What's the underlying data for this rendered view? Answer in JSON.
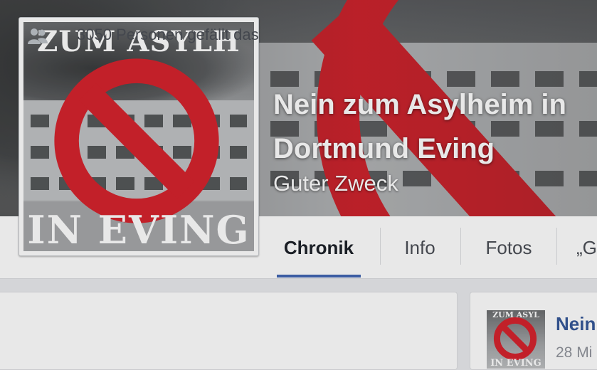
{
  "page": {
    "title": "Nein zum Asylheim in Dortmund Eving",
    "category": "Guter Zweck"
  },
  "profile_picture": {
    "text_top": "ZUM ASYLH",
    "text_bottom": "IN EVING",
    "sign_color": "#d6242e"
  },
  "tabs": [
    {
      "label": "Chronik",
      "active": true
    },
    {
      "label": "Info",
      "active": false
    },
    {
      "label": "Fotos",
      "active": false
    },
    {
      "label": "„G",
      "active": false
    }
  ],
  "likes": {
    "icon": "people-icon",
    "text": "3050 Personen gefällt das"
  },
  "post": {
    "author": "Nein",
    "date": "28 Mi",
    "thumb_top": "ZUM ASYL",
    "thumb_bottom": "IN EVING"
  },
  "colors": {
    "accent": "#4267b2",
    "link": "#365899",
    "sign_red": "#d6242e",
    "background": "#e9ebee"
  }
}
